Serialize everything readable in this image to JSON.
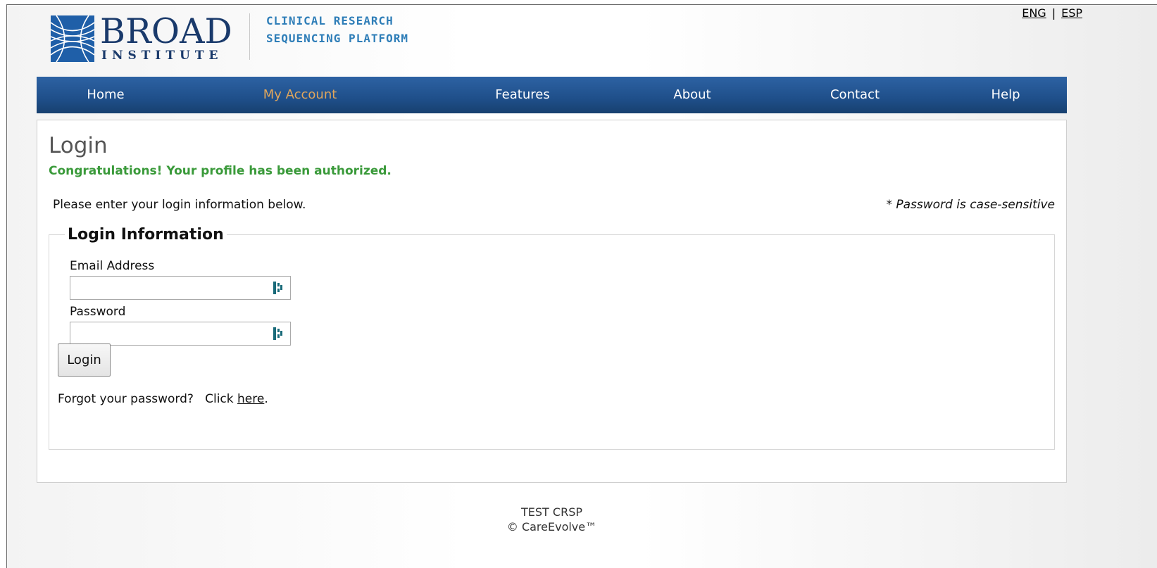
{
  "header": {
    "logo_name": "BROAD",
    "logo_sub": "INSTITUTE",
    "platform_line1": "CLINICAL RESEARCH",
    "platform_line2": "SEQUENCING PLATFORM",
    "lang_eng": "ENG",
    "lang_sep": "|",
    "lang_esp": "ESP"
  },
  "nav": {
    "items": [
      {
        "label": "Home",
        "active": false
      },
      {
        "label": "My Account",
        "active": true
      },
      {
        "label": "Features",
        "active": false
      },
      {
        "label": "About",
        "active": false
      },
      {
        "label": "Contact",
        "active": false
      },
      {
        "label": "Help",
        "active": false
      }
    ],
    "active_color": "#e0a65c",
    "bar_color": "#1f4f8a"
  },
  "main": {
    "title": "Login",
    "success_message": "Congratulations! Your profile has been authorized.",
    "intro": "Please enter your login information below.",
    "password_note": "* Password is case-sensitive",
    "fieldset_legend": "Login Information",
    "email_label": "Email Address",
    "email_value": "",
    "password_label": "Password",
    "password_value": "",
    "login_button": "Login",
    "forgot_text": "Forgot your password?   Click ",
    "forgot_link": "here",
    "forgot_end": ".",
    "input_icon": "password-manager-icon"
  },
  "footer": {
    "line1": "TEST CRSP",
    "line2": "© CareEvolve™"
  }
}
